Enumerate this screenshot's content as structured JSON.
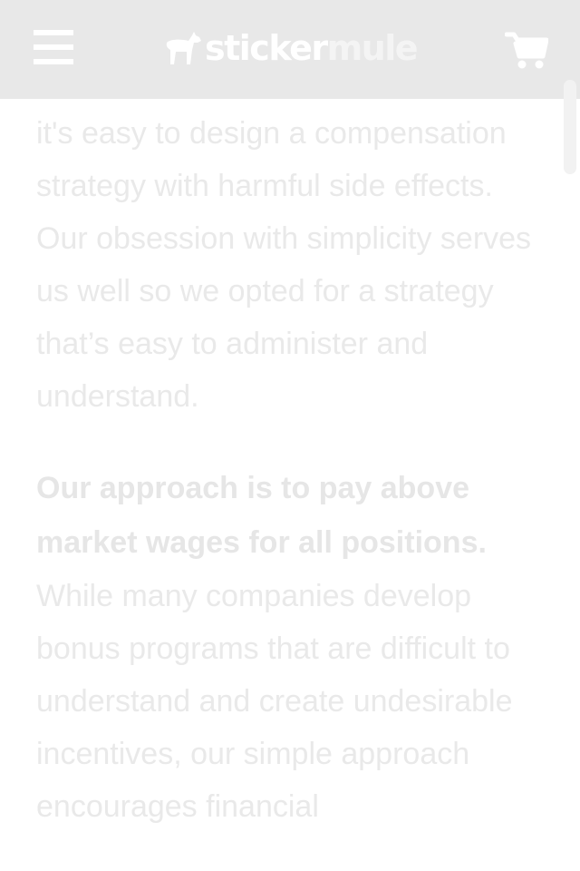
{
  "header": {
    "menu_icon": "hamburger-menu-icon",
    "logo": {
      "part1": "sticker",
      "part2": "mule",
      "mark_icon": "mule-logo-icon"
    },
    "cart_icon": "shopping-cart-icon"
  },
  "article": {
    "paragraph1": "it's easy to design a compensation strategy with harmful side effects. Our obsession with simplicity serves us well so we opted for a strategy that’s easy to administer and understand.",
    "paragraph2_bold": "Our approach is to pay above market wages for all positions.",
    "paragraph2_rest": "While many companies develop bonus programs that are difficult to understand and create undesirable incentives, our simple approach encourages financial"
  },
  "colors": {
    "header_bg": "#e8e8e8",
    "text": "#e9e9e9",
    "background": "#ffffff"
  }
}
